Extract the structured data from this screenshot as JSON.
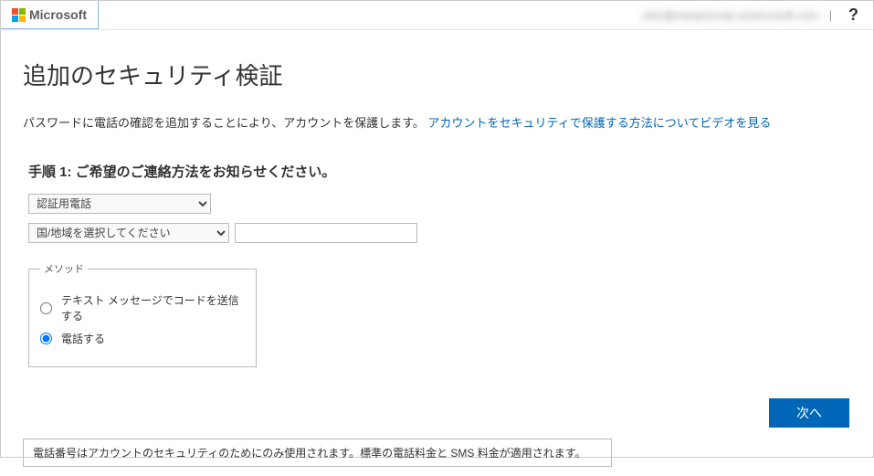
{
  "header": {
    "brand": "Microsoft",
    "user_email_masked": "john@martymcnair.onmicrosoft.com",
    "help_symbol": "?"
  },
  "page": {
    "title": "追加のセキュリティ検証",
    "description_prefix": "パスワードに電話の確認を追加することにより、アカウントを保護します。",
    "description_link": "アカウントをセキュリティで保護する方法についてビデオを見る",
    "step_heading": "手順 1: ご希望のご連絡方法をお知らせください。"
  },
  "form": {
    "auth_method_selected": "認証用電話",
    "region_selected": "国/地域を選択してください",
    "phone_value": "",
    "method_legend": "メソッド",
    "radio_sms_label": "テキスト メッセージでコードを送信する",
    "radio_call_label": "電話する",
    "radio_selected": "call"
  },
  "actions": {
    "next_label": "次へ"
  },
  "notice": {
    "text": "電話番号はアカウントのセキュリティのためにのみ使用されます。標準の電話料金と SMS 料金が適用されます。"
  }
}
